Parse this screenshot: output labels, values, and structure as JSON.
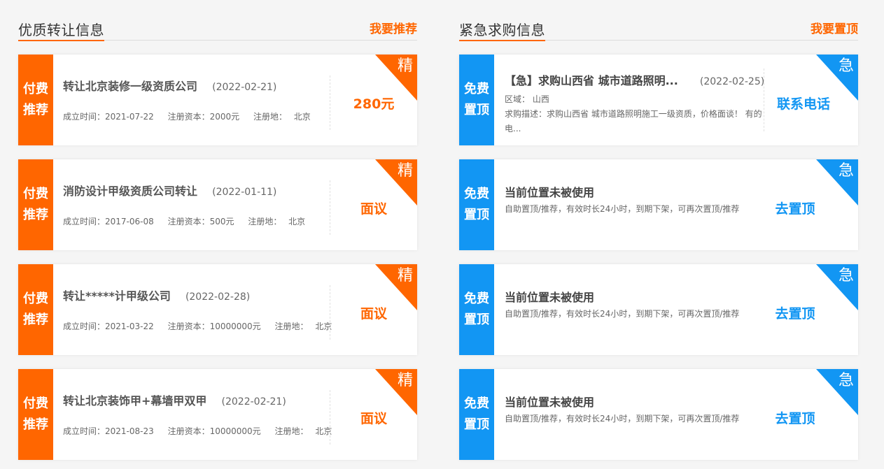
{
  "left_section": {
    "title": "优质转让信息",
    "link": "我要推荐",
    "cards": [
      {
        "tag_line1": "付费",
        "tag_line2": "推荐",
        "corner": "精",
        "title": "转让北京装修一级资质公司",
        "date": "(2022-02-21)",
        "founded": "成立时间：2021-07-22",
        "capital": "注册资本：2000元",
        "place_label": "注册地：",
        "place": "北京",
        "price": "280元"
      },
      {
        "tag_line1": "付费",
        "tag_line2": "推荐",
        "corner": "精",
        "title": "消防设计甲级资质公司转让",
        "date": "(2022-01-11)",
        "founded": "成立时间：2017-06-08",
        "capital": "注册资本：500元",
        "place_label": "注册地：",
        "place": "北京",
        "price": "面议"
      },
      {
        "tag_line1": "付费",
        "tag_line2": "推荐",
        "corner": "精",
        "title": "转让*****计甲级公司",
        "date": "(2022-02-28)",
        "founded": "成立时间：2021-03-22",
        "capital": "注册资本：10000000元",
        "place_label": "注册地：",
        "place": "北京",
        "price": "面议"
      },
      {
        "tag_line1": "付费",
        "tag_line2": "推荐",
        "corner": "精",
        "title": "转让北京装饰甲+幕墙甲双甲",
        "date": "(2022-02-21)",
        "founded": "成立时间：2021-08-23",
        "capital": "注册资本：10000000元",
        "place_label": "注册地：",
        "place": "北京",
        "price": "面议"
      }
    ]
  },
  "right_section": {
    "title": "紧急求购信息",
    "link": "我要置顶",
    "first_card": {
      "tag_line1": "免费",
      "tag_line2": "置顶",
      "corner": "急",
      "title": "【急】求购山西省 城市道路照明...",
      "date": "(2022-02-25)",
      "region": "区域：  山西",
      "desc": "求购描述：求购山西省 城市道路照明施工一级资质，价格面谈！ 有的电...",
      "action": "联系电话"
    },
    "empty_cards": [
      {
        "tag_line1": "免费",
        "tag_line2": "置顶",
        "corner": "急",
        "title": "当前位置未被使用",
        "sub": "自助置顶/推荐，有效时长24小时，到期下架，可再次置顶/推荐",
        "action": "去置顶"
      },
      {
        "tag_line1": "免费",
        "tag_line2": "置顶",
        "corner": "急",
        "title": "当前位置未被使用",
        "sub": "自助置顶/推荐，有效时长24小时，到期下架，可再次置顶/推荐",
        "action": "去置顶"
      },
      {
        "tag_line1": "免费",
        "tag_line2": "置顶",
        "corner": "急",
        "title": "当前位置未被使用",
        "sub": "自助置顶/推荐，有效时长24小时，到期下架，可再次置顶/推荐",
        "action": "去置顶"
      }
    ]
  },
  "colors": {
    "orange": "#ff6600",
    "blue": "#1296f3"
  }
}
